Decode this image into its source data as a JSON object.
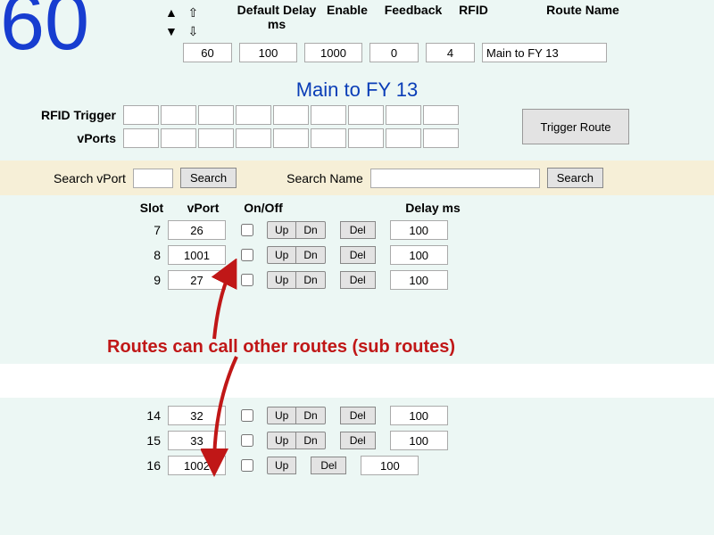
{
  "big_number": "60",
  "header": {
    "default_delay_label": "Default Delay ms",
    "enable_label": "Enable",
    "feedback_label": "Feedback",
    "rfid_label": "RFID",
    "route_name_label": "Route Name",
    "values": {
      "num": "60",
      "default_delay": "100",
      "enable": "1000",
      "feedback": "0",
      "rfid": "4",
      "route_name": "Main to FY 13"
    }
  },
  "route_title": "Main to FY 13",
  "rfid_trigger_label": "RFID Trigger",
  "vports_label": "vPorts",
  "trigger_route_label": "Trigger Route",
  "search": {
    "vport_label": "Search vPort",
    "name_label": "Search Name",
    "button": "Search"
  },
  "table_header": {
    "slot": "Slot",
    "vport": "vPort",
    "onoff": "On/Off",
    "delay": "Delay ms"
  },
  "btn": {
    "up": "Up",
    "dn": "Dn",
    "del": "Del"
  },
  "rows1": [
    {
      "slot": "7",
      "vport": "26",
      "delay": "100"
    },
    {
      "slot": "8",
      "vport": "1001",
      "delay": "100"
    },
    {
      "slot": "9",
      "vport": "27",
      "delay": "100"
    }
  ],
  "rows2": [
    {
      "slot": "14",
      "vport": "32",
      "delay": "100"
    },
    {
      "slot": "15",
      "vport": "33",
      "delay": "100"
    },
    {
      "slot": "16",
      "vport": "1002",
      "delay": "100",
      "no_dn": true
    }
  ],
  "callout": "Routes can call other routes (sub routes)"
}
